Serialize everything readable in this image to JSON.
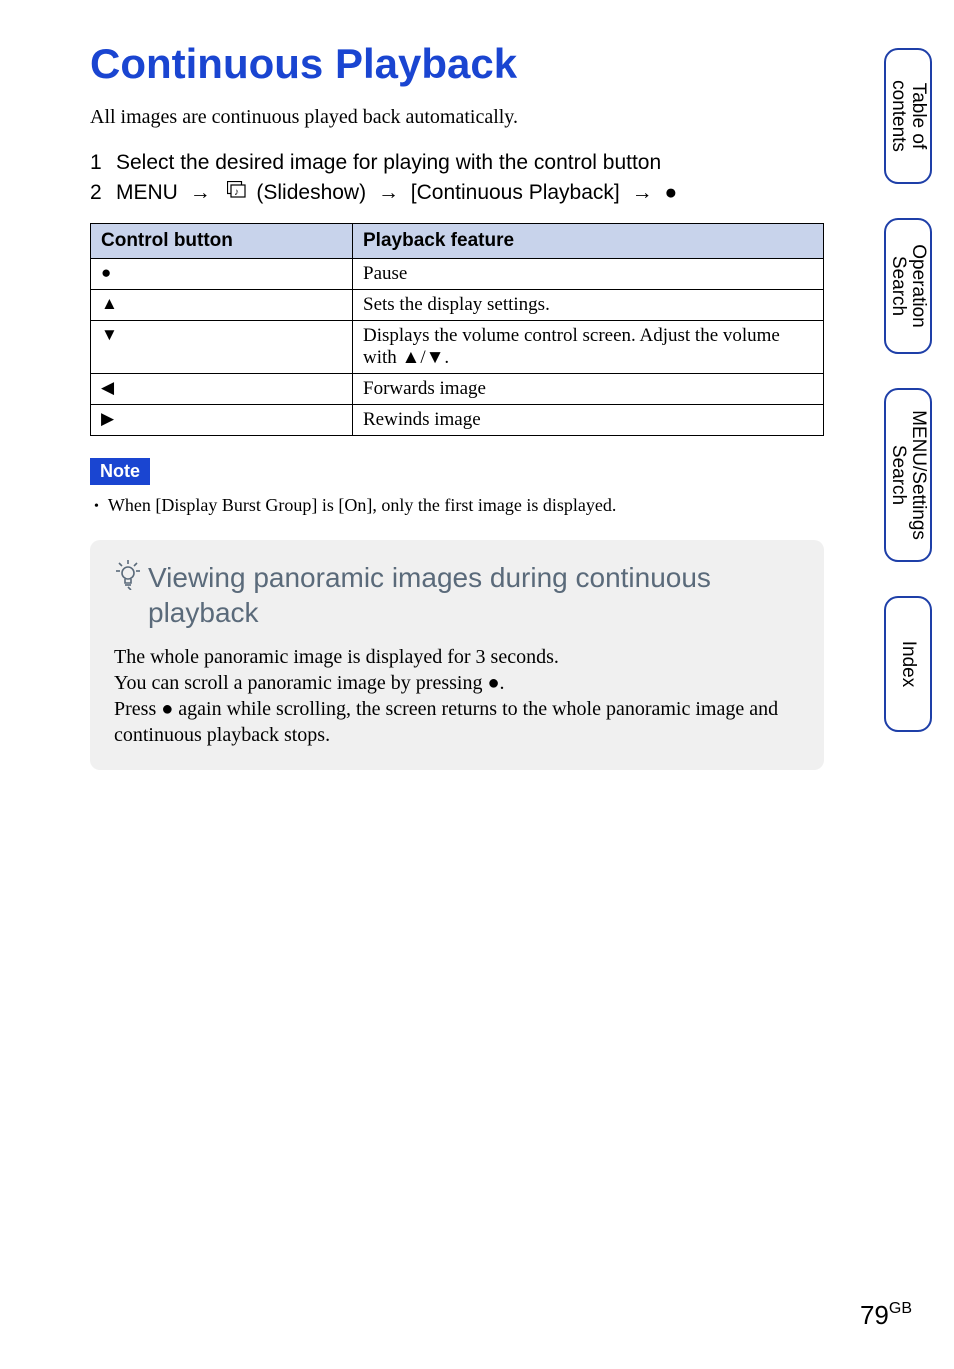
{
  "title": "Continuous Playback",
  "intro": "All images are continuous played back automatically.",
  "steps": [
    {
      "num": "1",
      "text": "Select the desired image for playing with the control button"
    },
    {
      "num": "2",
      "prefix": "MENU",
      "slideshow_label": "(Slideshow)",
      "mid": "[Continuous Playback]"
    }
  ],
  "table": {
    "headers": [
      "Control button",
      "Playback feature"
    ],
    "rows": [
      {
        "sym": "●",
        "feat": "Pause"
      },
      {
        "sym": "▲",
        "feat": "Sets the display settings."
      },
      {
        "sym": "▼",
        "feat_prefix": "Displays the volume control screen. Adjust the volume with ",
        "feat_suffix": "▲/▼."
      },
      {
        "sym": "◀",
        "feat": "Forwards image"
      },
      {
        "sym": "▶",
        "feat": "Rewinds image"
      }
    ]
  },
  "note": {
    "label": "Note",
    "text": "When [Display Burst Group] is [On], only the first image is displayed."
  },
  "tip": {
    "title": "Viewing panoramic images during continuous playback",
    "body_lines": [
      "The whole panoramic image is displayed for 3 seconds.",
      "You can scroll a panoramic image by pressing ●.",
      "Press ● again while scrolling, the screen returns to the whole panoramic image and continuous playback stops."
    ]
  },
  "tabs": [
    "Table of\ncontents",
    "Operation\nSearch",
    "MENU/Settings\nSearch",
    "Index"
  ],
  "page_number": "79",
  "page_suffix": "GB"
}
